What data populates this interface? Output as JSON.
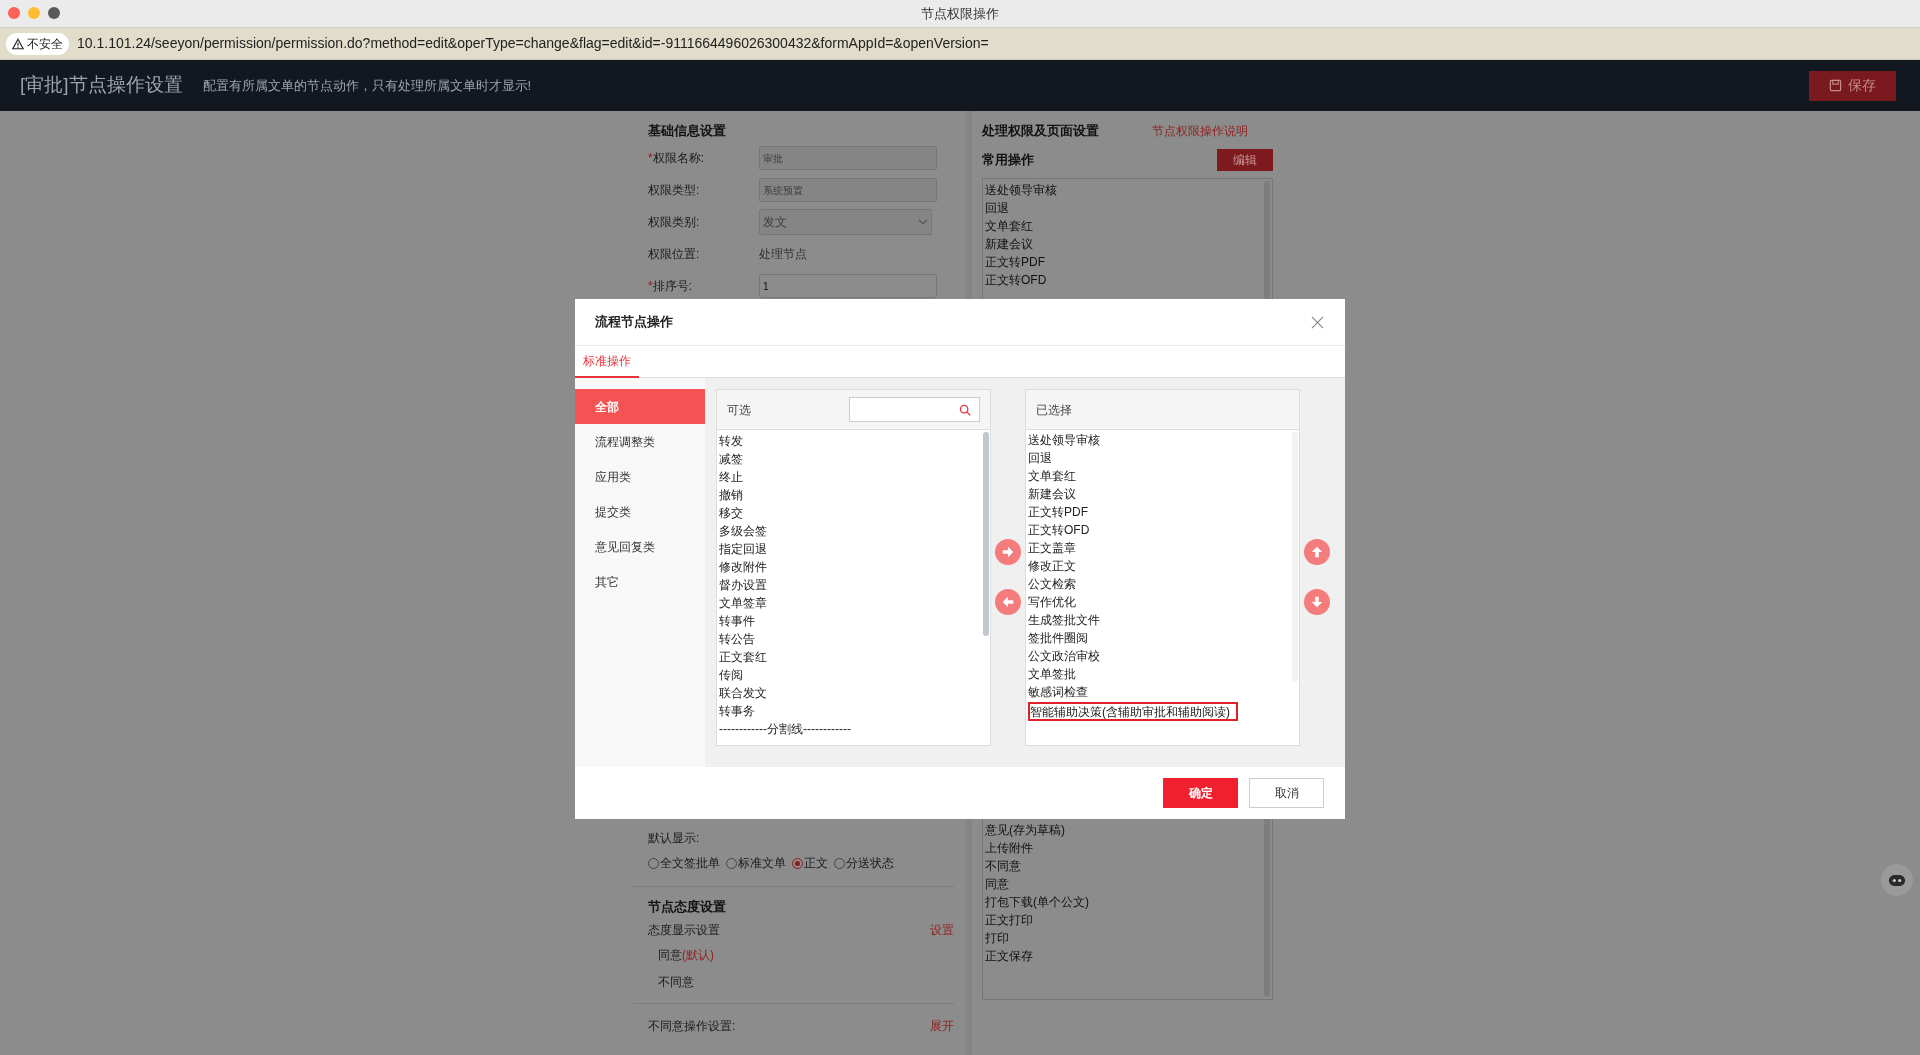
{
  "window": {
    "title": "节点权限操作"
  },
  "address_bar": {
    "security": "不安全",
    "url": "10.1.101.24/seeyon/permission/permission.do?method=edit&operType=change&flag=edit&id=-9111664496026300432&formAppId=&openVersion="
  },
  "header": {
    "title": "[审批]节点操作设置",
    "subtitle": "配置有所属文单的节点动作，只有处理所属文单时才显示!",
    "save_button": "保存"
  },
  "basic_info": {
    "title": "基础信息设置",
    "fields": [
      {
        "marker": "*",
        "label": "权限名称:",
        "kind": "input",
        "disabled": true,
        "value": "审批"
      },
      {
        "label": "权限类型:",
        "kind": "input",
        "disabled": true,
        "value": "系统预置"
      },
      {
        "label": "权限类别:",
        "kind": "select",
        "disabled": true,
        "value": "发文"
      },
      {
        "label": "权限位置:",
        "kind": "text",
        "value": "处理节点"
      },
      {
        "marker": "*",
        "label": "排序号:",
        "kind": "input",
        "disabled": false,
        "value": "1"
      }
    ]
  },
  "default_display": {
    "label": "默认显示:",
    "options": [
      {
        "label": "全文签批单",
        "selected": false
      },
      {
        "label": "标准文单",
        "selected": false
      },
      {
        "label": "正文",
        "selected": true
      },
      {
        "label": "分送状态",
        "selected": false
      }
    ]
  },
  "attitude": {
    "title": "节点态度设置",
    "setting_label": "态度显示设置",
    "setting_link": "设置",
    "items": [
      {
        "text": "同意",
        "tag": "(默认)"
      },
      {
        "text": "不同意"
      }
    ]
  },
  "disagree": {
    "label": "不同意操作设置:",
    "link": "展开"
  },
  "permissions": {
    "title": "处理权限及页面设置",
    "help_link": "节点权限操作说明",
    "common_ops_title": "常用操作",
    "edit_button": "编辑",
    "ops_top": [
      "送处领导审核",
      "回退",
      "文单套红",
      "新建会议",
      "正文转PDF",
      "正文转OFD"
    ],
    "ops_bottom": [
      "意见(存为草稿)",
      "上传附件",
      "不同意",
      "同意",
      "打包下载(单个公文)",
      "正文打印",
      "打印",
      "正文保存"
    ]
  },
  "dialog": {
    "title": "流程节点操作",
    "tabs": [
      {
        "label": "标准操作",
        "selected": true
      }
    ],
    "categories": [
      {
        "label": "全部",
        "selected": true
      },
      {
        "label": "流程调整类",
        "selected": false
      },
      {
        "label": "应用类",
        "selected": false
      },
      {
        "label": "提交类",
        "selected": false
      },
      {
        "label": "意见回复类",
        "selected": false
      },
      {
        "label": "其它",
        "selected": false
      }
    ],
    "available": {
      "title": "可选",
      "items": [
        "转发",
        "减签",
        "终止",
        "撤销",
        "移交",
        "多级会签",
        "指定回退",
        "修改附件",
        "督办设置",
        "文单签章",
        "转事件",
        "转公告",
        "正文套红",
        "传阅",
        "联合发文",
        "转事务",
        "------------分割线------------"
      ]
    },
    "chosen": {
      "title": "已选择",
      "items": [
        {
          "text": "送处领导审核",
          "highlighted": false
        },
        {
          "text": "回退",
          "highlighted": false
        },
        {
          "text": "文单套红",
          "highlighted": false
        },
        {
          "text": "新建会议",
          "highlighted": false
        },
        {
          "text": "正文转PDF",
          "highlighted": false
        },
        {
          "text": "正文转OFD",
          "highlighted": false
        },
        {
          "text": "正文盖章",
          "highlighted": false
        },
        {
          "text": "修改正文",
          "highlighted": false
        },
        {
          "text": "公文检索",
          "highlighted": false
        },
        {
          "text": "写作优化",
          "highlighted": false
        },
        {
          "text": "生成签批文件",
          "highlighted": false
        },
        {
          "text": "签批件圈阅",
          "highlighted": false
        },
        {
          "text": "公文政治审校",
          "highlighted": false
        },
        {
          "text": "文单签批",
          "highlighted": false
        },
        {
          "text": "敏感词检查",
          "highlighted": false
        },
        {
          "text": "智能辅助决策(含辅助审批和辅助阅读)",
          "highlighted": true
        }
      ]
    },
    "confirm_button": "确定",
    "cancel_button": "取消"
  }
}
